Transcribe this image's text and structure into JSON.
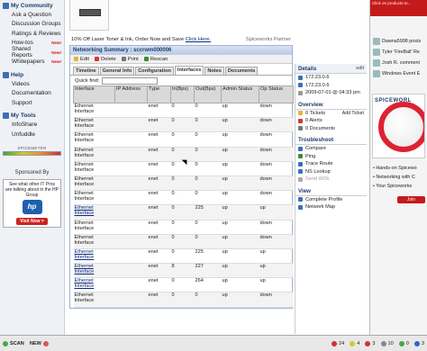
{
  "sidebar": {
    "community_title": "My Community",
    "community_items": [
      {
        "label": "Ask a Question",
        "badge": ""
      },
      {
        "label": "Discussion Groups",
        "badge": ""
      },
      {
        "label": "Ratings & Reviews",
        "badge": ""
      },
      {
        "label": "How-tos",
        "badge": "New!"
      },
      {
        "label": "Shared Reports",
        "badge": "New!"
      },
      {
        "label": "Whitepapers",
        "badge": "New!"
      }
    ],
    "help_title": "Help",
    "help_items": [
      "Videos",
      "Documentation",
      "Support"
    ],
    "tools_title": "My Tools",
    "tools_items": [
      "InfoShare",
      "Unfuddle"
    ],
    "spicemeter_label": "SPICEMETER",
    "sponsor_label": "Sponsored By",
    "sponsor_ad": {
      "text": "See what other IT Pros are talking about in the HP Group",
      "logo": "hp",
      "cta": "Visit Now >"
    }
  },
  "main": {
    "ad_text": "10% Off Laser Toner & Ink, Order Now and Save",
    "ad_link": "Click Here.",
    "partner": "Spiceworks Partner",
    "panel_title": "Networking Summary : sccrwm000006",
    "toolbar": {
      "edit": "Edit",
      "delete": "Delete",
      "print": "Print",
      "rescan": "Rescan"
    },
    "tabs": [
      "Timeline",
      "General Info",
      "Configuration",
      "Interfaces",
      "Notes",
      "Documents"
    ],
    "active_tab": "Interfaces",
    "quickfind_label": "Quick find:",
    "quickfind_value": "",
    "columns": [
      "Interface",
      "IP Address",
      "Type",
      "In(Bps)",
      "Out(Bps)",
      "Admin Status",
      "Op Status"
    ],
    "rows": [
      {
        "interface": "Ethernet Interface",
        "ip": "",
        "type": "enet",
        "in": "0",
        "out": "0",
        "admin": "up",
        "op": "down",
        "link": false
      },
      {
        "interface": "Ethernet Interface",
        "ip": "",
        "type": "enet",
        "in": "0",
        "out": "0",
        "admin": "up",
        "op": "down",
        "link": false
      },
      {
        "interface": "Ethernet Interface",
        "ip": "",
        "type": "enet",
        "in": "0",
        "out": "0",
        "admin": "up",
        "op": "down",
        "link": false
      },
      {
        "interface": "Ethernet Interface",
        "ip": "",
        "type": "enet",
        "in": "0",
        "out": "0",
        "admin": "up",
        "op": "down",
        "link": false
      },
      {
        "interface": "Ethernet Interface",
        "ip": "",
        "type": "enet",
        "in": "0",
        "out": "0",
        "admin": "up",
        "op": "down",
        "link": false
      },
      {
        "interface": "Ethernet Interface",
        "ip": "",
        "type": "enet",
        "in": "0",
        "out": "0",
        "admin": "up",
        "op": "down",
        "link": false
      },
      {
        "interface": "Ethernet Interface",
        "ip": "",
        "type": "enet",
        "in": "0",
        "out": "0",
        "admin": "up",
        "op": "down",
        "link": false
      },
      {
        "interface": "Ethernet Interface",
        "ip": "",
        "type": "enet",
        "in": "0",
        "out": "225",
        "admin": "up",
        "op": "up",
        "link": true
      },
      {
        "interface": "Ethernet Interface",
        "ip": "",
        "type": "enet",
        "in": "0",
        "out": "0",
        "admin": "up",
        "op": "down",
        "link": false
      },
      {
        "interface": "Ethernet Interface",
        "ip": "",
        "type": "enet",
        "in": "0",
        "out": "0",
        "admin": "up",
        "op": "down",
        "link": false
      },
      {
        "interface": "Ethernet Interface",
        "ip": "",
        "type": "enet",
        "in": "0",
        "out": "225",
        "admin": "up",
        "op": "up",
        "link": true
      },
      {
        "interface": "Ethernet Interface",
        "ip": "",
        "type": "enet",
        "in": "8",
        "out": "227",
        "admin": "up",
        "op": "up",
        "link": true
      },
      {
        "interface": "Ethernet Interface",
        "ip": "",
        "type": "enet",
        "in": "0",
        "out": "264",
        "admin": "up",
        "op": "up",
        "link": true
      },
      {
        "interface": "Ethernet Interface",
        "ip": "",
        "type": "enet",
        "in": "0",
        "out": "0",
        "admin": "up",
        "op": "down",
        "link": false
      }
    ]
  },
  "details": {
    "title": "Details",
    "edit": "edit",
    "items": [
      "172.23.0.6",
      "172.23.0.6",
      "2009-07-01 @ 04:33 pm"
    ],
    "overview_title": "Overview",
    "overview": [
      "0 Tickets",
      "0 Alerts",
      "0 Documents"
    ],
    "add_ticket": "Add Ticket",
    "troubleshoot_title": "Troubleshoot",
    "troubleshoot": [
      "Compare",
      "Ping",
      "Trace Route",
      "NS Lookup",
      "Send WOL"
    ],
    "view_title": "View",
    "view": [
      "Complete Profile",
      "Network Map"
    ]
  },
  "right": {
    "promo": "Click on products to...",
    "feed": [
      "Dawna5998 posts",
      "Tyler 'FireBall' Re",
      "Josh R. comment",
      "Windows Event E"
    ],
    "banner": "SPICEWORL",
    "bullets": [
      "Hands-on Spicewo",
      "Networking with C",
      "Your Spiceworks"
    ],
    "join": "Join"
  },
  "bottombar": {
    "scan": "SCAN",
    "new": "NEW",
    "indicators": [
      {
        "value": "24",
        "color": "#c33"
      },
      {
        "value": "4",
        "color": "#cc3"
      },
      {
        "value": "3",
        "color": "#c33"
      },
      {
        "value": "10",
        "color": "#888"
      },
      {
        "value": "0",
        "color": "#4a4"
      },
      {
        "value": "3",
        "color": "#36c"
      }
    ]
  }
}
